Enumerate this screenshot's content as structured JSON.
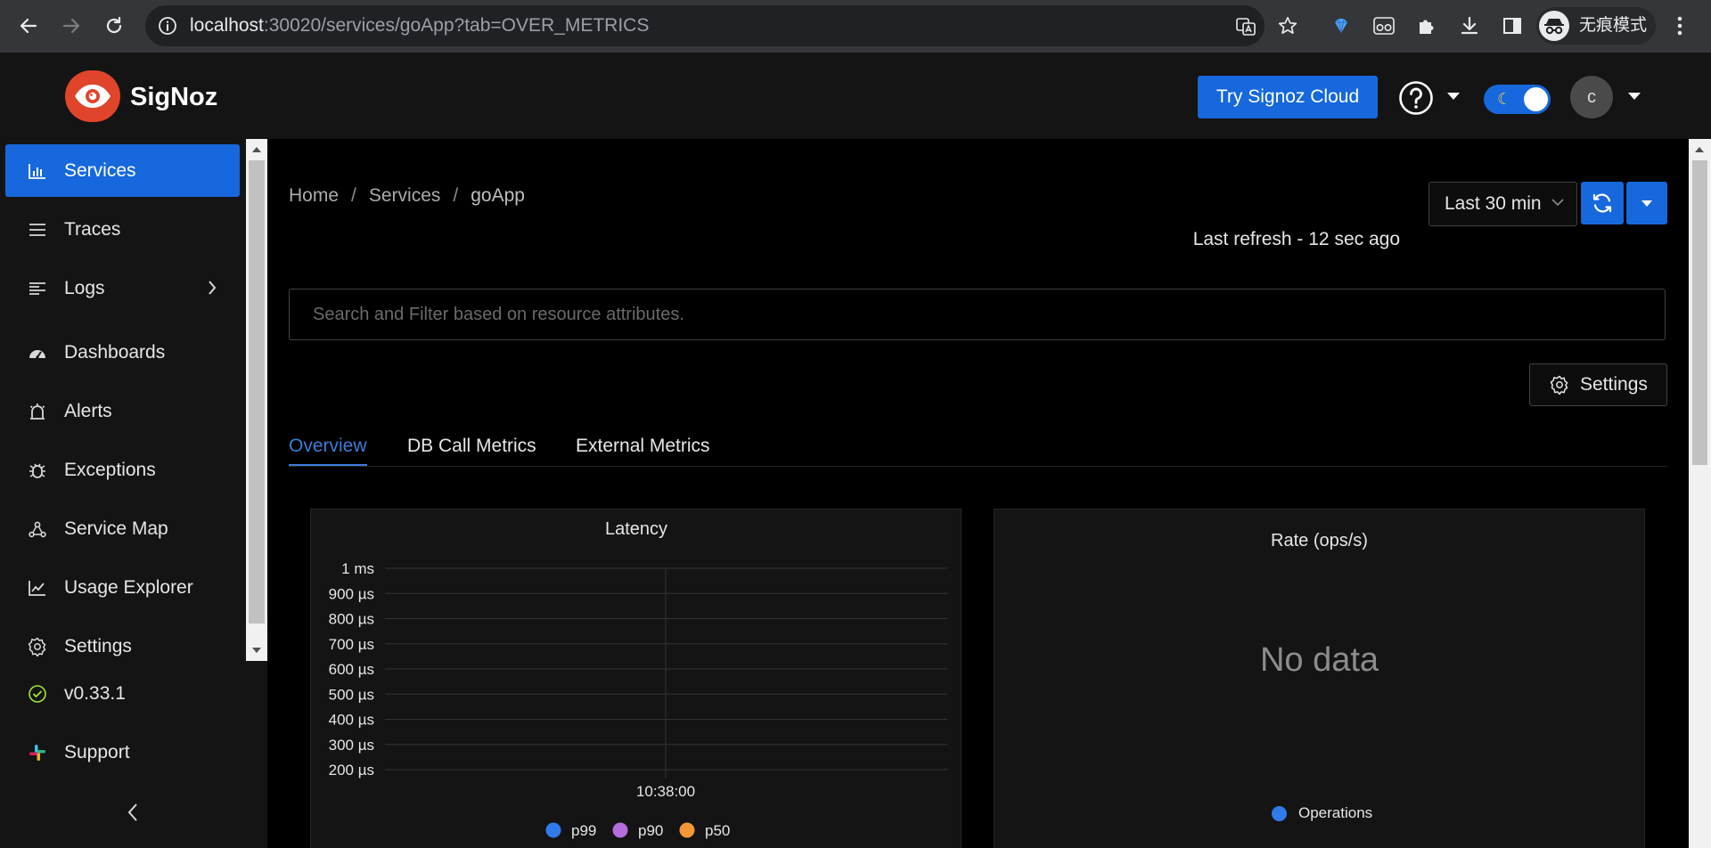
{
  "browser": {
    "url_host": "localhost",
    "url_rest": ":30020/services/goApp?tab=OVER_METRICS",
    "profile_label": "无痕模式"
  },
  "header": {
    "brand": "SigNoz",
    "try_cloud": "Try Signoz Cloud",
    "avatar_initial": "c",
    "theme": "dark"
  },
  "sidebar": {
    "items": [
      {
        "label": "Services",
        "icon": "bar-chart-icon",
        "active": true
      },
      {
        "label": "Traces",
        "icon": "menu-icon"
      },
      {
        "label": "Logs",
        "icon": "align-left-icon",
        "expandable": true
      },
      {
        "label": "Dashboards",
        "icon": "dashboard-icon"
      },
      {
        "label": "Alerts",
        "icon": "alarm-icon"
      },
      {
        "label": "Exceptions",
        "icon": "bug-icon"
      },
      {
        "label": "Service Map",
        "icon": "deployment-icon"
      },
      {
        "label": "Usage Explorer",
        "icon": "line-chart-icon"
      },
      {
        "label": "Settings",
        "icon": "gear-icon"
      }
    ],
    "version": "v0.33.1",
    "support": "Support"
  },
  "main": {
    "breadcrumb": [
      "Home",
      "Services",
      "goApp"
    ],
    "time_range": "Last 30 min",
    "last_refresh": "Last refresh - 12 sec ago",
    "search_placeholder": "Search and Filter based on resource attributes.",
    "settings_label": "Settings",
    "tabs": [
      {
        "label": "Overview",
        "active": true
      },
      {
        "label": "DB Call Metrics"
      },
      {
        "label": "External Metrics"
      }
    ],
    "rate_card": {
      "title": "Rate (ops/s)",
      "empty": "No data",
      "legend": "Operations",
      "legend_color": "#2f7bea"
    }
  },
  "chart_data": {
    "type": "line",
    "title": "Latency",
    "y_ticks": [
      "1 ms",
      "900 µs",
      "800 µs",
      "700 µs",
      "600 µs",
      "500 µs",
      "400 µs",
      "300 µs",
      "200 µs"
    ],
    "x_ticks": [
      "10:38:00"
    ],
    "ylim": [
      "200 µs",
      "1 ms"
    ],
    "grid": true,
    "legend_position": "bottom",
    "series": [
      {
        "name": "p99",
        "color": "#2f7bea",
        "values": []
      },
      {
        "name": "p90",
        "color": "#b56ddb",
        "values": []
      },
      {
        "name": "p50",
        "color": "#f2963a",
        "values": []
      }
    ]
  }
}
